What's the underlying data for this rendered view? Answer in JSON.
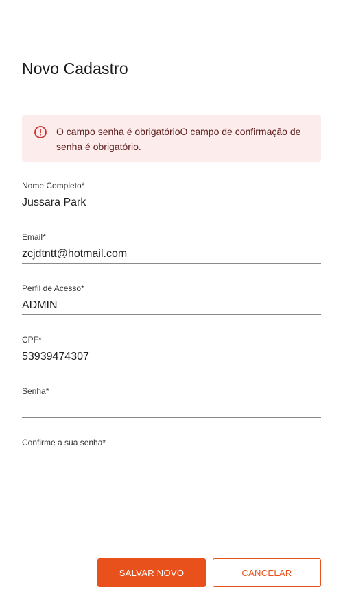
{
  "page": {
    "title": "Novo Cadastro"
  },
  "alert": {
    "icon": "error-circle-icon",
    "message": "O campo senha é obrigatórioO campo de confirmação de senha é obrigatório."
  },
  "form": {
    "nome": {
      "label": "Nome Completo*",
      "value": "Jussara Park"
    },
    "email": {
      "label": "Email*",
      "value": "zcjdtntt@hotmail.com"
    },
    "perfil": {
      "label": "Perfil de Acesso*",
      "value": "ADMIN"
    },
    "cpf": {
      "label": "CPF*",
      "value": "53939474307"
    },
    "senha": {
      "label": "Senha*",
      "value": ""
    },
    "confirmacao": {
      "label": "Confirme a sua senha*",
      "value": ""
    }
  },
  "actions": {
    "save_label": "SALVAR NOVO",
    "cancel_label": "CANCELAR"
  },
  "colors": {
    "accent": "#e8511c",
    "alert_bg": "#fdecec",
    "alert_text": "#5f2120",
    "alert_icon": "#d32f2f"
  }
}
